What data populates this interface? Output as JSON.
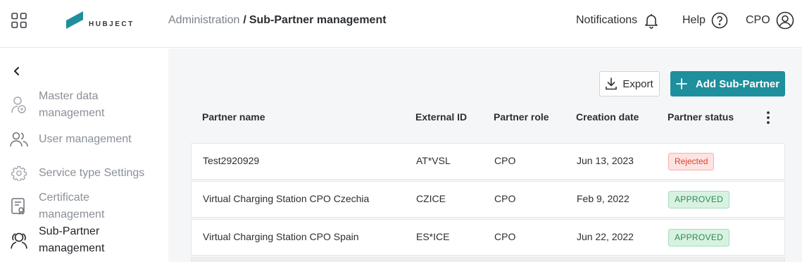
{
  "header": {
    "apps_icon": "grid-apps-icon",
    "logo_text": "HUBJECT",
    "brand_color": "#1e8f9c",
    "breadcrumb": {
      "parent": "Administration",
      "separator": "/",
      "current": "Sub-Partner management"
    },
    "notifications_label": "Notifications",
    "help_label": "Help",
    "user_label": "CPO"
  },
  "sidebar": {
    "items": [
      {
        "label_line1": "Master data",
        "label_line2": "management",
        "icon": "master-data-icon"
      },
      {
        "label_line1": "User management",
        "label_line2": "",
        "icon": "users-icon"
      },
      {
        "label_line1": "Service type Settings",
        "label_line2": "",
        "icon": "gear-icon"
      },
      {
        "label_line1": "Certificate",
        "label_line2": "management",
        "icon": "certificate-icon"
      },
      {
        "label_line1": "Sub-Partner",
        "label_line2": "management",
        "icon": "sub-partner-icon",
        "active": true
      }
    ]
  },
  "toolbar": {
    "export_label": "Export",
    "add_label": "Add Sub-Partner"
  },
  "table": {
    "columns": [
      "Partner name",
      "External ID",
      "Partner role",
      "Creation date",
      "Partner status"
    ],
    "rows": [
      {
        "name": "Test2920929",
        "external_id": "AT*VSL",
        "role": "CPO",
        "date": "Jun 13, 2023",
        "status": "Rejected",
        "status_type": "rejected"
      },
      {
        "name": "Virtual Charging Station CPO Czechia",
        "external_id": "CZICE",
        "role": "CPO",
        "date": "Feb 9, 2022",
        "status": "APPROVED",
        "status_type": "approved"
      },
      {
        "name": "Virtual Charging Station CPO Spain",
        "external_id": "ES*ICE",
        "role": "CPO",
        "date": "Jun 22, 2022",
        "status": "APPROVED",
        "status_type": "approved"
      }
    ]
  },
  "colors": {
    "rejected_bg": "#fde3e1",
    "rejected_text": "#d64434",
    "approved_bg": "#d8f2e2",
    "approved_text": "#2d8a53"
  }
}
